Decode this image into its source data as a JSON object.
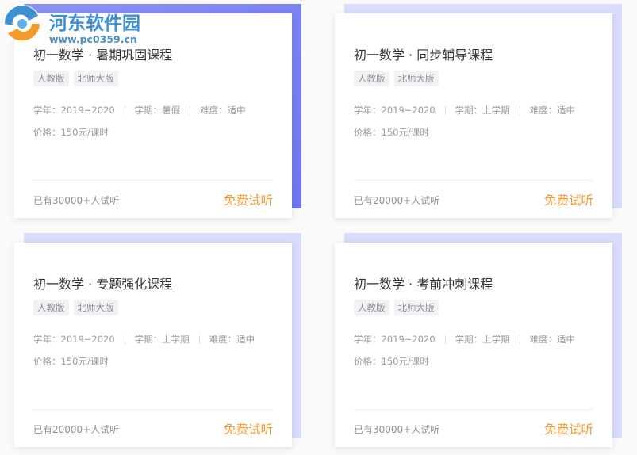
{
  "watermark": {
    "name": "河东软件园",
    "url": "www.pc0359.cn",
    "icon": "hedong-logo-icon"
  },
  "colors": {
    "accent": "#f09a36",
    "card_highlight": "#7a82f0",
    "card_backdrop": "#d9dcfb"
  },
  "cards": [
    {
      "title": "初一数学 · 暑期巩固课程",
      "tags": [
        "人教版",
        "北师大版"
      ],
      "year": "学年：2019~2020",
      "term": "学期：暑假",
      "difficulty": "难度：适中",
      "price": "价格：150元/课时",
      "count": "已有30000+人试听",
      "cta": "免费试听",
      "active": true
    },
    {
      "title": "初一数学 · 同步辅导课程",
      "tags": [
        "人教版",
        "北师大版"
      ],
      "year": "学年：2019~2020",
      "term": "学期：上学期",
      "difficulty": "难度：适中",
      "price": "价格：150元/课时",
      "count": "已有20000+人试听",
      "cta": "免费试听",
      "active": false
    },
    {
      "title": "初一数学 · 专题强化课程",
      "tags": [
        "人教版",
        "北师大版"
      ],
      "year": "学年：2019~2020",
      "term": "学期：上学期",
      "difficulty": "难度：适中",
      "price": "价格：150元/课时",
      "count": "已有20000+人试听",
      "cta": "免费试听",
      "active": false
    },
    {
      "title": "初一数学 · 考前冲刺课程",
      "tags": [
        "人教版",
        "北师大版"
      ],
      "year": "学年：2019~2020",
      "term": "学期：上学期",
      "difficulty": "难度：适中",
      "price": "价格：150元/课时",
      "count": "已有30000+人试听",
      "cta": "免费试听",
      "active": false
    }
  ]
}
